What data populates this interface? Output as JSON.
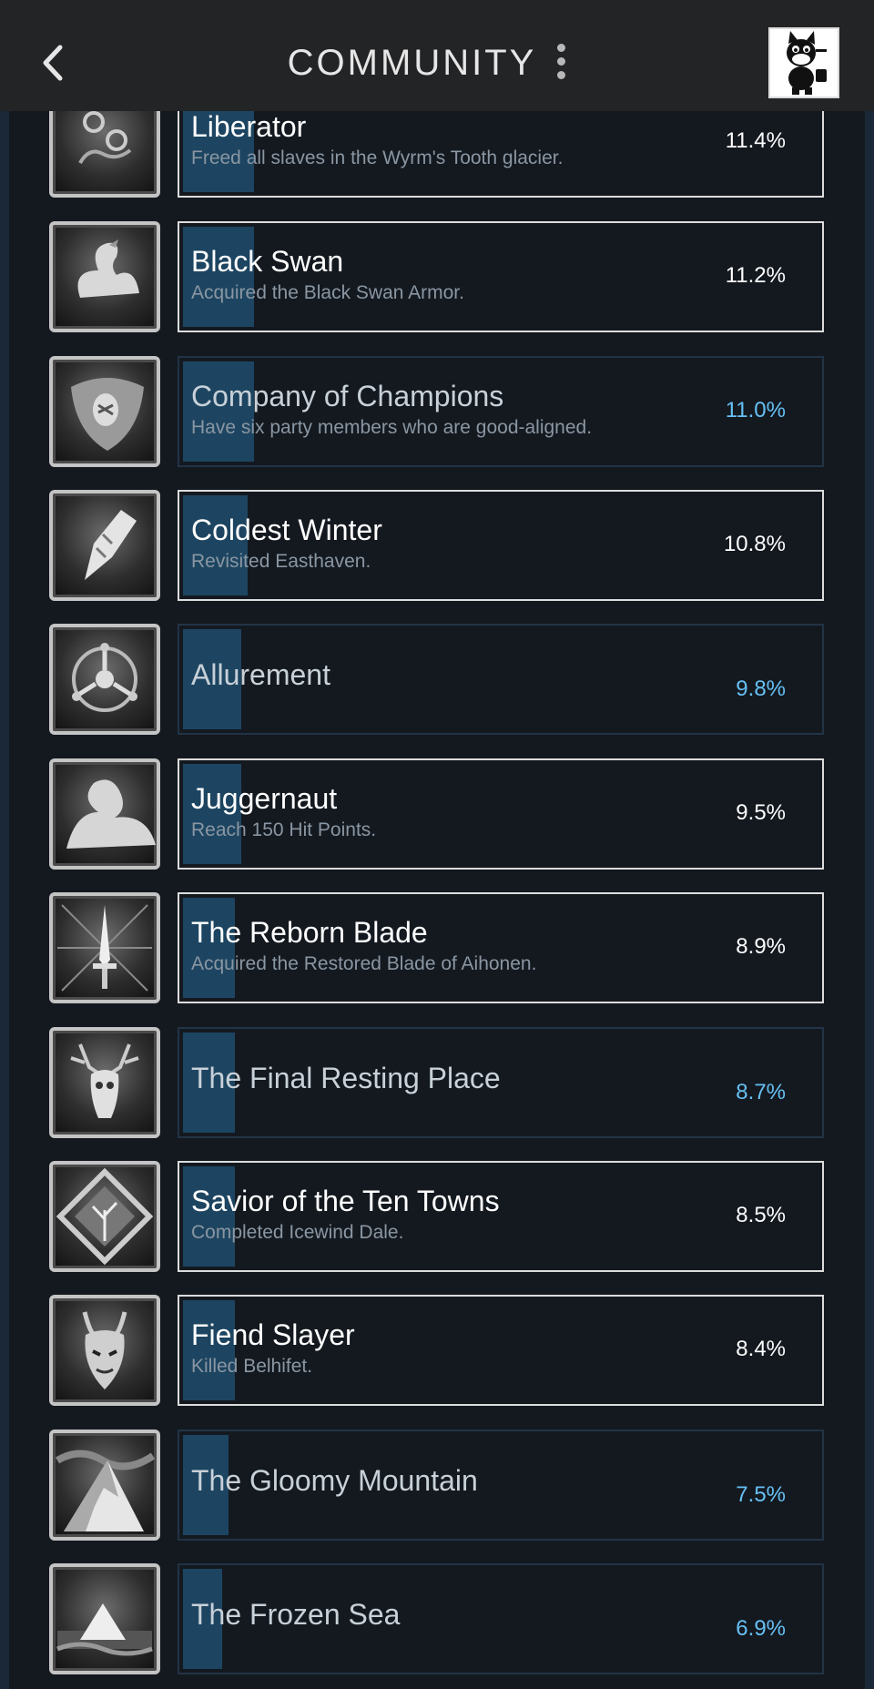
{
  "header": {
    "title": "COMMUNITY",
    "back_icon": "chevron-left-icon",
    "menu_icon": "kebab-menu-icon",
    "avatar_icon": "cartoon-cat-avatar"
  },
  "colors": {
    "background": "#1b2838",
    "header": "#232426",
    "locked_percent": "#66c0f4",
    "progress_fill": "#1d4561"
  },
  "achievements": [
    {
      "name": "Liberator",
      "description": "Freed all slaves in the Wyrm's Tooth glacier.",
      "percent": "11.4%",
      "unlocked": true,
      "icon": "shackles-icon"
    },
    {
      "name": "Black Swan",
      "description": "Acquired the Black Swan Armor.",
      "percent": "11.2%",
      "unlocked": true,
      "icon": "swan-icon"
    },
    {
      "name": "Company of Champions",
      "description": "Have six party members who are good-aligned.",
      "percent": "11.0%",
      "unlocked": false,
      "icon": "champions-medallion-icon"
    },
    {
      "name": "Coldest Winter",
      "description": "Revisited Easthaven.",
      "percent": "10.8%",
      "unlocked": true,
      "icon": "ice-shard-icon"
    },
    {
      "name": "Allurement",
      "description": "",
      "percent": "9.8%",
      "unlocked": false,
      "icon": "triskelion-icon"
    },
    {
      "name": "Juggernaut",
      "description": "Reach 150 Hit Points.",
      "percent": "9.5%",
      "unlocked": true,
      "icon": "flexed-arm-icon"
    },
    {
      "name": "The Reborn Blade",
      "description": "Acquired the Restored Blade of Aihonen.",
      "percent": "8.9%",
      "unlocked": true,
      "icon": "radiant-sword-icon"
    },
    {
      "name": "The Final Resting Place",
      "description": "",
      "percent": "8.7%",
      "unlocked": false,
      "icon": "elk-skull-icon"
    },
    {
      "name": "Savior of the Ten Towns",
      "description": "Completed Icewind Dale.",
      "percent": "8.5%",
      "unlocked": true,
      "icon": "tree-emblem-icon"
    },
    {
      "name": "Fiend Slayer",
      "description": "Killed Belhifet.",
      "percent": "8.4%",
      "unlocked": true,
      "icon": "demon-head-icon"
    },
    {
      "name": "The Gloomy Mountain",
      "description": "",
      "percent": "7.5%",
      "unlocked": false,
      "icon": "mountain-peak-icon"
    },
    {
      "name": "The Frozen Sea",
      "description": "",
      "percent": "6.9%",
      "unlocked": false,
      "icon": "frozen-sea-icon"
    }
  ]
}
